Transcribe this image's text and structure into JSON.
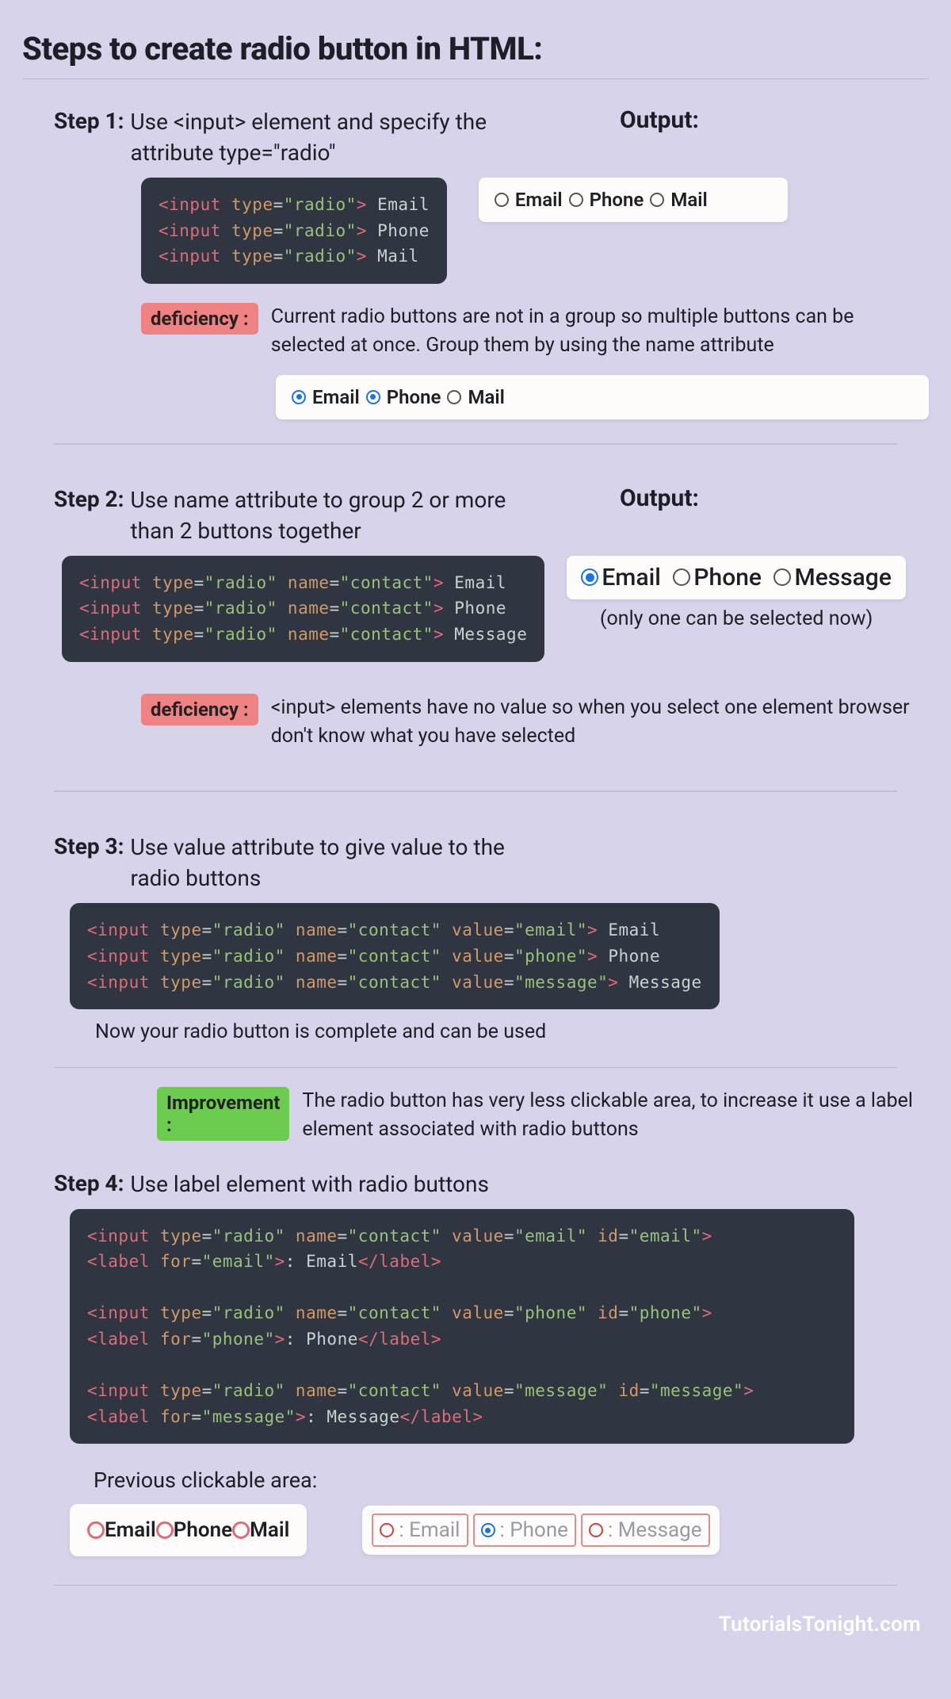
{
  "title": "Steps to create radio button in HTML:",
  "footer": "TutorialsTonight.com",
  "labels": {
    "output": "Output:",
    "deficiency": "deficiency :",
    "improvement": "Improvement :",
    "previous_area": "Previous clickable area:"
  },
  "step1": {
    "label": "Step 1:",
    "text": "Use <input> element and specify the attribute type=\"radio\"",
    "code_lines": [
      "<input type=\"radio\"> Email",
      "<input type=\"radio\"> Phone",
      "<input type=\"radio\"> Mail"
    ],
    "output_items": [
      "Email",
      "Phone",
      "Mail"
    ],
    "deficiency_text": "Current radio buttons are not in a group so multiple buttons can be selected at once. Group them by using the name attribute",
    "deficiency_demo_items": [
      "Email",
      "Phone",
      "Mail"
    ]
  },
  "step2": {
    "label": "Step 2:",
    "text": "Use name attribute to group 2 or more than 2 buttons together",
    "code_lines": [
      "<input type=\"radio\" name=\"contact\"> Email",
      "<input type=\"radio\" name=\"contact\"> Phone",
      "<input type=\"radio\" name=\"contact\"> Message"
    ],
    "output_items": [
      "Email",
      "Phone",
      "Message"
    ],
    "output_note": "(only one can be selected now)",
    "deficiency_text": "<input> elements have no value so when you select one element browser don't know what you have selected"
  },
  "step3": {
    "label": "Step 3:",
    "text": "Use value attribute to give value to the radio buttons",
    "code_lines": [
      "<input type=\"radio\" name=\"contact\" value=\"email\"> Email",
      "<input type=\"radio\" name=\"contact\" value=\"phone\"> Phone",
      "<input type=\"radio\" name=\"contact\" value=\"message\"> Message"
    ],
    "note": "Now your radio button is complete and can be used",
    "improvement_text": "The radio button has very less clickable area, to increase it use a label element associated with radio buttons"
  },
  "step4": {
    "label": "Step 4:",
    "text": "Use label element with radio buttons",
    "code_lines": [
      "<input type=\"radio\" name=\"contact\" value=\"email\" id=\"email\">",
      "<label for=\"email\">: Email</label>",
      "",
      "<input type=\"radio\" name=\"contact\" value=\"phone\" id=\"phone\">",
      "<label for=\"phone\">: Phone</label>",
      "",
      "<input type=\"radio\" name=\"contact\" value=\"message\" id=\"message\">",
      "<label for=\"message\">: Message</label>"
    ],
    "previous_items": [
      "Email",
      "Phone",
      "Mail"
    ],
    "new_items": [
      ": Email",
      ": Phone",
      ": Message"
    ]
  }
}
